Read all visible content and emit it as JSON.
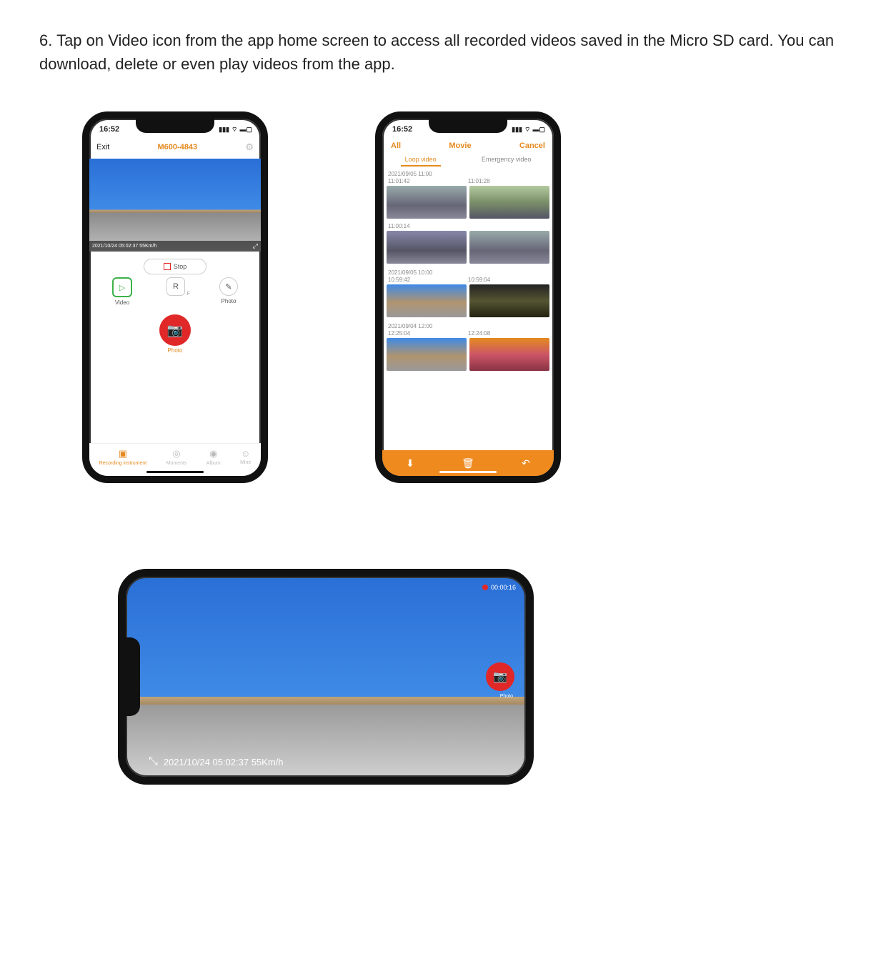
{
  "instruction": "6.   Tap on Video icon from the app home screen to access all recorded videos saved in the Micro SD card. You can download, delete or even play videos from the app.",
  "phone1": {
    "time": "16:52",
    "exit": "Exit",
    "title": "M600-4843",
    "overlay": "2021/10/24 05:02:37 55Km/h",
    "stop": "Stop",
    "video": "Video",
    "r_label": "R",
    "f_sub": "F",
    "photo": "Photo",
    "shutter_label": "Photo",
    "tabs": {
      "rec": "Recording instrument",
      "moments": "Moments",
      "album": "Album",
      "mine": "Mine"
    }
  },
  "phone2": {
    "time": "16:52",
    "all": "All",
    "movie": "Movie",
    "cancel": "Cancel",
    "loop": "Loop video",
    "emergency": "Emergency video",
    "sec1_hdr": "2021/09/05 11:00",
    "sec1_t1": "11:01:42",
    "sec1_t2": "11:01:28",
    "sec1_t3": "11:00:14",
    "sec2_hdr": "2021/09/05 10:00",
    "sec2_t1": "10:59:42",
    "sec2_t2": "10:59:04",
    "sec3_hdr": "2021/09/04 12:00",
    "sec3_t1": "12:25:04",
    "sec3_t2": "12:24:08"
  },
  "phone3": {
    "rec_time": "00:00:16",
    "overlay": "2021/10/24 05:02:37 55Km/h",
    "shutter_label": "Photo"
  }
}
